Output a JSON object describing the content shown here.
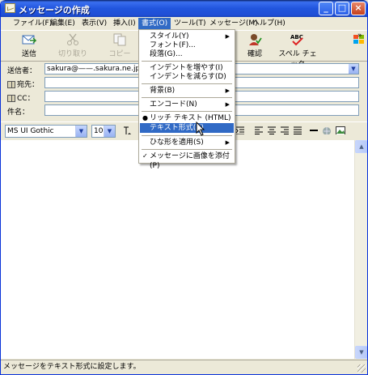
{
  "window": {
    "title": "メッセージの作成"
  },
  "menubar": {
    "items": [
      {
        "label": "ファイル(F)"
      },
      {
        "label": "編集(E)"
      },
      {
        "label": "表示(V)"
      },
      {
        "label": "挿入(I)"
      },
      {
        "label": "書式(O)"
      },
      {
        "label": "ツール(T)"
      },
      {
        "label": "メッセージ(M)"
      },
      {
        "label": "ヘルプ(H)"
      }
    ]
  },
  "toolbar": {
    "send": "送信",
    "cut": "切り取り",
    "copy": "コピー",
    "check": "確認",
    "spell": "スペル チェック",
    "spell_icon_text": "ABC",
    "overflow": "»"
  },
  "headers": {
    "from_label": "送信者：",
    "from_value": "sakura@——.sakura.ne.jp   (sak",
    "to_label": "宛先：",
    "cc_label": "CC：",
    "subject_label": "件名："
  },
  "format": {
    "font": "MS UI Gothic",
    "size": "10"
  },
  "format_menu": {
    "items": [
      {
        "label": "スタイル(Y)",
        "submenu": true
      },
      {
        "label": "フォント(F)..."
      },
      {
        "label": "段落(G)..."
      },
      {
        "label": "インデントを増やす(I)"
      },
      {
        "label": "インデントを減らす(D)"
      },
      {
        "label": "背景(B)",
        "submenu": true
      },
      {
        "label": "エンコード(N)",
        "submenu": true
      },
      {
        "label": "リッチ テキスト (HTML)(R)",
        "mark": "●"
      },
      {
        "label": "テキスト形式(X)",
        "highlighted": true
      },
      {
        "label": "ひな形を適用(S)",
        "submenu": true
      },
      {
        "label": "メッセージに画像を添付(P)",
        "mark": "✓"
      }
    ]
  },
  "status": {
    "text": "メッセージをテキスト形式に設定します。"
  },
  "colors": {
    "titlebar": "#2155dd",
    "menu_highlight": "#316ac5",
    "window_face": "#ece9d8"
  }
}
